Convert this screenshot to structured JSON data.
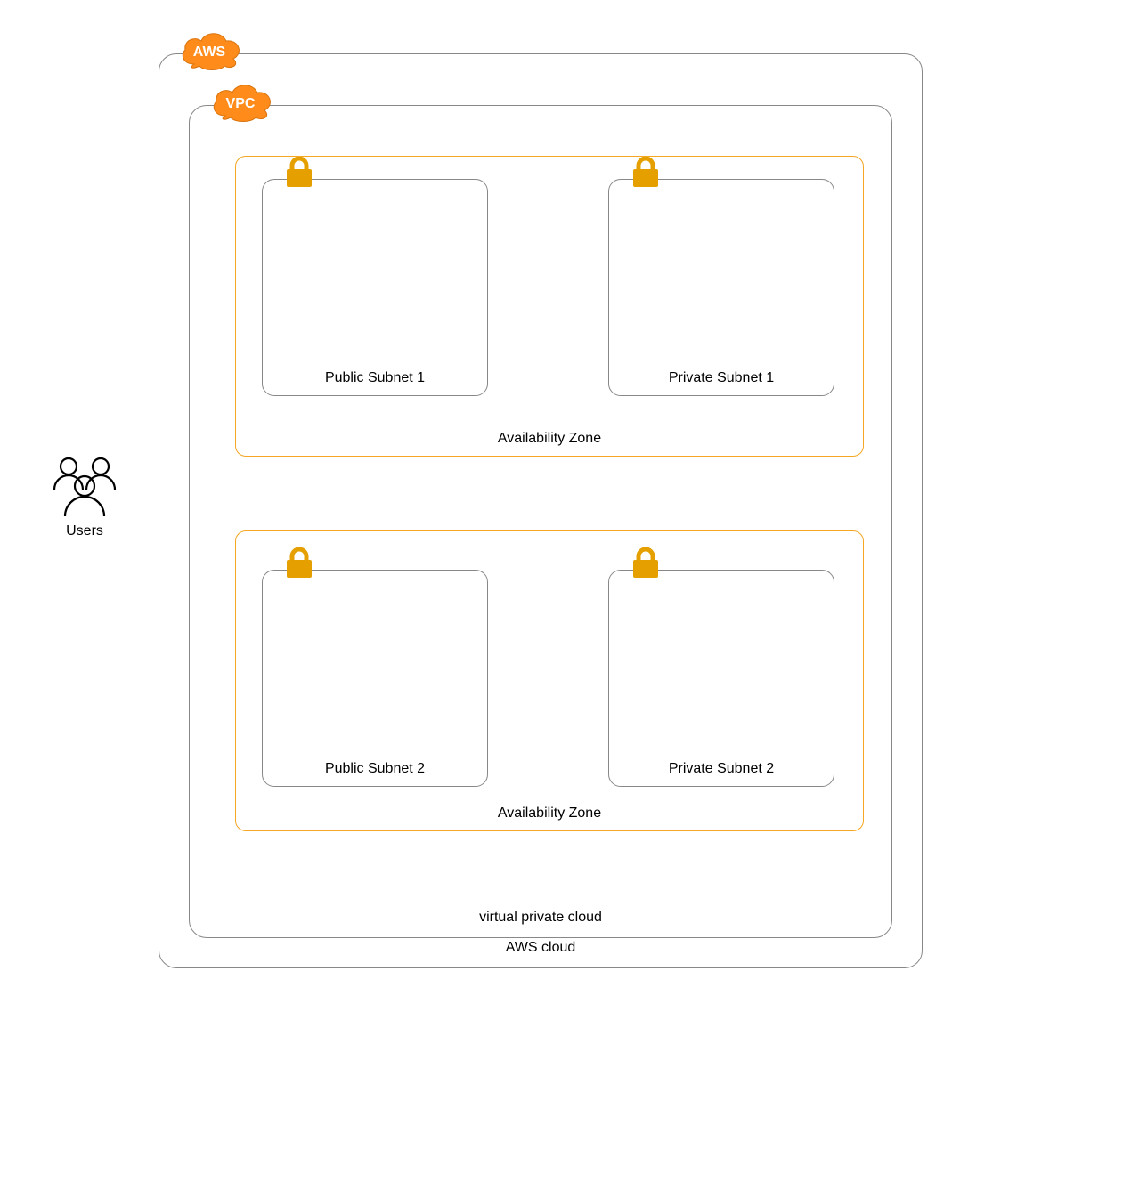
{
  "users_label": "Users",
  "aws_badge": "AWS",
  "vpc_badge": "VPC",
  "aws_cloud_label": "AWS cloud",
  "vpc_label": "virtual private cloud",
  "az1_label": "Availability Zone",
  "az2_label": "Availability Zone",
  "public_subnet_1": "Public Subnet 1",
  "private_subnet_1": "Private Subnet 1",
  "public_subnet_2": "Public Subnet 2",
  "private_subnet_2": "Private Subnet 2",
  "colors": {
    "aws_orange": "#F58536",
    "az_orange": "#F5A623",
    "lock_gold": "#E5A000",
    "grey": "#888888"
  }
}
